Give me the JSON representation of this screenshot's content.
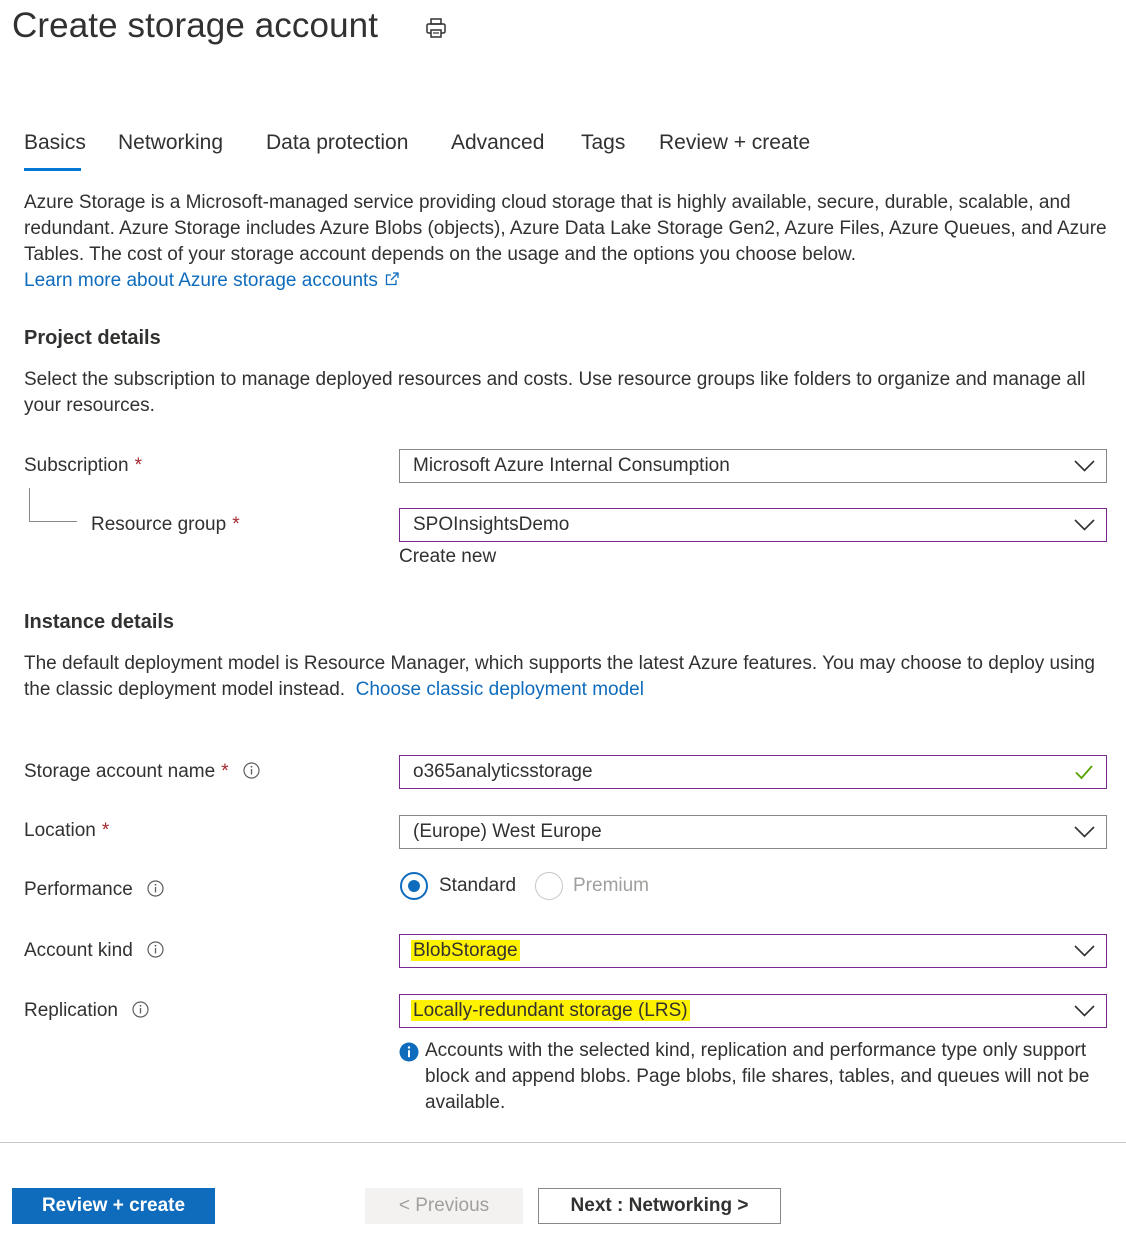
{
  "page": {
    "title": "Create storage account",
    "print_icon": "print-icon"
  },
  "tabs": [
    {
      "label": "Basics",
      "active": true
    },
    {
      "label": "Networking",
      "active": false
    },
    {
      "label": "Data protection",
      "active": false
    },
    {
      "label": "Advanced",
      "active": false
    },
    {
      "label": "Tags",
      "active": false
    },
    {
      "label": "Review + create",
      "active": false
    }
  ],
  "intro": {
    "text": "Azure Storage is a Microsoft-managed service providing cloud storage that is highly available, secure, durable, scalable, and redundant. Azure Storage includes Azure Blobs (objects), Azure Data Lake Storage Gen2, Azure Files, Azure Queues, and Azure Tables. The cost of your storage account depends on the usage and the options you choose below.",
    "link": "Learn more about Azure storage accounts",
    "link_icon": "external-link-icon"
  },
  "project_details": {
    "heading": "Project details",
    "description": "Select the subscription to manage deployed resources and costs. Use resource groups like folders to organize and manage all your resources.",
    "subscription": {
      "label": "Subscription",
      "required": "*",
      "value": "Microsoft Azure Internal Consumption"
    },
    "resource_group": {
      "label": "Resource group",
      "required": "*",
      "value": "SPOInsightsDemo",
      "create_new": "Create new"
    }
  },
  "instance_details": {
    "heading": "Instance details",
    "description": "The default deployment model is Resource Manager, which supports the latest Azure features. You may choose to deploy using the classic deployment model instead.",
    "classic_link": "Choose classic deployment model",
    "storage_account_name": {
      "label": "Storage account name",
      "required": "*",
      "value": "o365analyticsstorage",
      "valid_icon": "checkmark-icon"
    },
    "location": {
      "label": "Location",
      "required": "*",
      "value": "(Europe) West Europe"
    },
    "performance": {
      "label": "Performance",
      "options": [
        "Standard",
        "Premium"
      ],
      "selected": "Standard"
    },
    "account_kind": {
      "label": "Account kind",
      "value": "BlobStorage"
    },
    "replication": {
      "label": "Replication",
      "value": "Locally-redundant storage (LRS)"
    },
    "notice": "Accounts with the selected kind, replication and performance type only support block and append blobs. Page blobs, file shares, tables, and queues will not be available."
  },
  "footer": {
    "review_create": "Review + create",
    "previous": "< Previous",
    "next": "Next : Networking >"
  },
  "colors": {
    "accent": "#0f6cbd",
    "required": "#a4262c",
    "highlight": "#fff200",
    "focus_border": "#7a2a8c",
    "valid": "#57a300"
  }
}
